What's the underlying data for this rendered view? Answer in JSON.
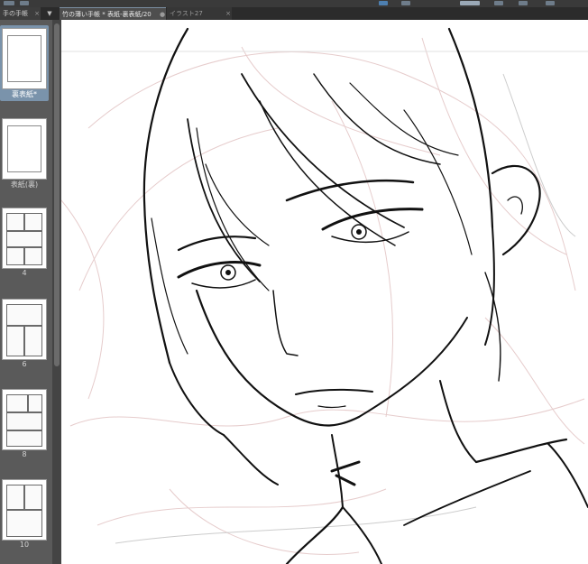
{
  "tabs": [
    {
      "label": "手の手帳",
      "close": "×"
    },
    {
      "label": "▼"
    },
    {
      "label": "竹の薄い手帳 * 表紙-裏表紙/20",
      "close": "●"
    },
    {
      "label": "イラスト27",
      "close": "×"
    }
  ],
  "pages": [
    {
      "label": "裏表紙*",
      "selected": true
    },
    {
      "label": "表紙(裏)",
      "selected": false
    },
    {
      "label": "4",
      "selected": false
    },
    {
      "label": "6",
      "selected": false
    },
    {
      "label": "8",
      "selected": false
    },
    {
      "label": "10",
      "selected": false
    }
  ],
  "colors": {
    "panel": "#5a5a5a",
    "selection": "#7a93ab",
    "canvas": "#ffffff",
    "ink": "#111111",
    "sketch": "#e6cccc"
  }
}
